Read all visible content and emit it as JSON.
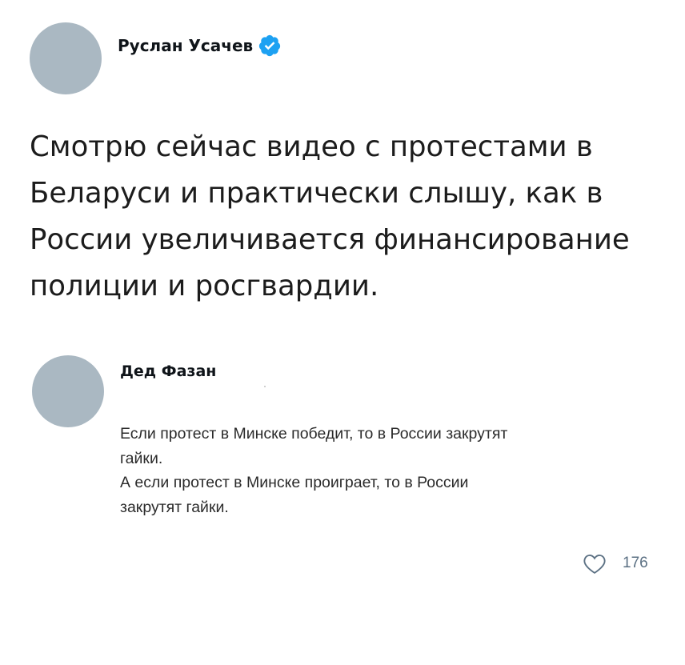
{
  "main_tweet": {
    "author_name": "Руслан Усачев",
    "verified": true,
    "text_lines": [
      "Смотрю сейчас видео с протестами в",
      "Беларуси и практически слышу, как в",
      "России увеличивается финансирование",
      "полиции и росгвардии."
    ]
  },
  "reply": {
    "author_name": "Дед Фазан",
    "text_lines": [
      "Если протест в Минске победит, то в России закрутят",
      "гайки.",
      "А если протест в Минске проиграет, то в России",
      "закрутят гайки."
    ],
    "like_count": "176"
  },
  "colors": {
    "avatar": "#aab8c2",
    "verified_badge": "#1da1f2",
    "muted_text": "#5b7083"
  },
  "icons": {
    "verified": "verified-badge-icon",
    "like": "heart-outline-icon"
  }
}
